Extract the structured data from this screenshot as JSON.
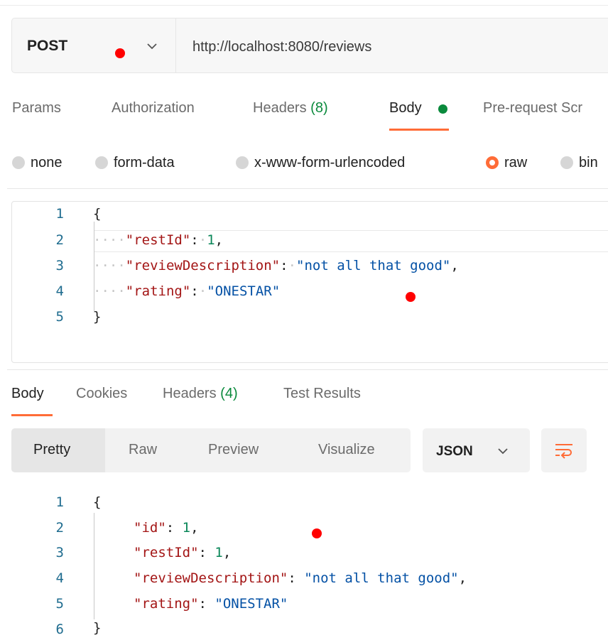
{
  "request": {
    "method": "POST",
    "url": "http://localhost:8080/reviews",
    "tabs": [
      {
        "label": "Params",
        "count": ""
      },
      {
        "label": "Authorization",
        "count": ""
      },
      {
        "label": "Headers",
        "count": "(8)"
      },
      {
        "label": "Body",
        "count": ""
      },
      {
        "label": "Pre-request Scr",
        "count": ""
      }
    ],
    "active_tab": "Body",
    "body_modes": [
      "none",
      "form-data",
      "x-www-form-urlencoded",
      "raw",
      "bin"
    ],
    "selected_body_mode": "raw",
    "body_lines": [
      {
        "num": "1",
        "text": "{"
      },
      {
        "num": "2",
        "key": "\"restId\"",
        "value": "1",
        "trail": ","
      },
      {
        "num": "3",
        "key": "\"reviewDescription\"",
        "value": "\"not all that good\"",
        "trail": ","
      },
      {
        "num": "4",
        "key": "\"rating\"",
        "value": "\"ONESTAR\"",
        "trail": ""
      },
      {
        "num": "5",
        "text": "}"
      }
    ]
  },
  "response": {
    "tabs": [
      {
        "label": "Body",
        "count": ""
      },
      {
        "label": "Cookies",
        "count": ""
      },
      {
        "label": "Headers",
        "count": "(4)"
      },
      {
        "label": "Test Results",
        "count": ""
      }
    ],
    "active_tab": "Body",
    "view_modes": [
      "Pretty",
      "Raw",
      "Preview",
      "Visualize"
    ],
    "selected_view": "Pretty",
    "format": "JSON",
    "body_lines": [
      {
        "num": "1",
        "text": "{"
      },
      {
        "num": "2",
        "key": "\"id\"",
        "value": "1",
        "trail": ","
      },
      {
        "num": "3",
        "key": "\"restId\"",
        "value": "1",
        "trail": ","
      },
      {
        "num": "4",
        "key": "\"reviewDescription\"",
        "value": "\"not all that good\"",
        "trail": ","
      },
      {
        "num": "5",
        "key": "\"rating\"",
        "value": "\"ONESTAR\"",
        "trail": ""
      },
      {
        "num": "6",
        "text": "}"
      }
    ]
  },
  "icons": {
    "method_dropdown": "chevron-down-icon",
    "format_dropdown": "chevron-down-icon",
    "wrap_lines": "wrap-lines-icon",
    "body_status_dot": "green-dot-icon"
  },
  "colors": {
    "accent": "#ff6c37",
    "count_green": "#0a8a3c",
    "json_key": "#a31515",
    "json_string": "#0451a5",
    "json_number": "#098658",
    "line_number": "#1f6c8f",
    "annotation_dot": "#ff0000"
  }
}
